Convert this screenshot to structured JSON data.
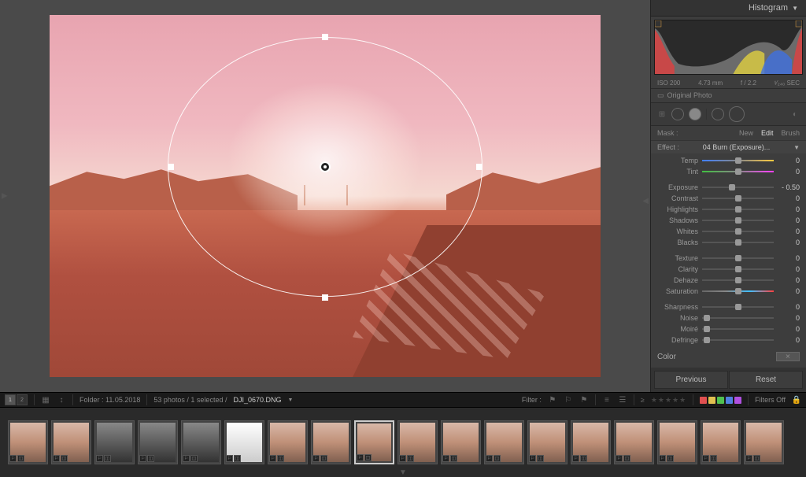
{
  "histogram": {
    "title": "Histogram",
    "iso": "ISO 200",
    "focal": "4.73 mm",
    "aperture": "f / 2.2",
    "shutter": "¹⁄₂₄₀ SEC",
    "original": "Original Photo"
  },
  "mask": {
    "label": "Mask :",
    "new": "New",
    "edit": "Edit",
    "brush": "Brush"
  },
  "effect": {
    "label": "Effect :",
    "preset": "04 Burn (Exposure)..."
  },
  "sliders": {
    "temp": {
      "label": "Temp",
      "value": "0",
      "pos": 50
    },
    "tint": {
      "label": "Tint",
      "value": "0",
      "pos": 50
    },
    "exposure": {
      "label": "Exposure",
      "value": "- 0.50",
      "pos": 42
    },
    "contrast": {
      "label": "Contrast",
      "value": "0",
      "pos": 50
    },
    "highlights": {
      "label": "Highlights",
      "value": "0",
      "pos": 50
    },
    "shadows": {
      "label": "Shadows",
      "value": "0",
      "pos": 50
    },
    "whites": {
      "label": "Whites",
      "value": "0",
      "pos": 50
    },
    "blacks": {
      "label": "Blacks",
      "value": "0",
      "pos": 50
    },
    "texture": {
      "label": "Texture",
      "value": "0",
      "pos": 50
    },
    "clarity": {
      "label": "Clarity",
      "value": "0",
      "pos": 50
    },
    "dehaze": {
      "label": "Dehaze",
      "value": "0",
      "pos": 50
    },
    "saturation": {
      "label": "Saturation",
      "value": "0",
      "pos": 50
    },
    "sharpness": {
      "label": "Sharpness",
      "value": "0",
      "pos": 50
    },
    "noise": {
      "label": "Noise",
      "value": "0",
      "pos": 7
    },
    "moire": {
      "label": "Moiré",
      "value": "0",
      "pos": 7
    },
    "defringe": {
      "label": "Defringe",
      "value": "0",
      "pos": 7
    }
  },
  "colorLabel": "Color",
  "buttons": {
    "previous": "Previous",
    "reset": "Reset"
  },
  "toolbar": {
    "folder": "Folder : 11.05.2018",
    "count": "53 photos / 1 selected /",
    "filename": "DJI_0670.DNG",
    "filter": "Filter :",
    "filtersOff": "Filters Off",
    "colors": [
      "#e05050",
      "#e0c050",
      "#50c050",
      "#5080e0",
      "#b050e0"
    ]
  },
  "thumbs": [
    {
      "v": "norm"
    },
    {
      "v": "norm"
    },
    {
      "v": "dark"
    },
    {
      "v": "dark"
    },
    {
      "v": "dark"
    },
    {
      "v": "high"
    },
    {
      "v": "norm"
    },
    {
      "v": "norm"
    },
    {
      "v": "norm",
      "sel": true
    },
    {
      "v": "norm"
    },
    {
      "v": "norm"
    },
    {
      "v": "norm"
    },
    {
      "v": "norm"
    },
    {
      "v": "norm"
    },
    {
      "v": "norm"
    },
    {
      "v": "norm"
    },
    {
      "v": "norm"
    },
    {
      "v": "norm"
    }
  ]
}
